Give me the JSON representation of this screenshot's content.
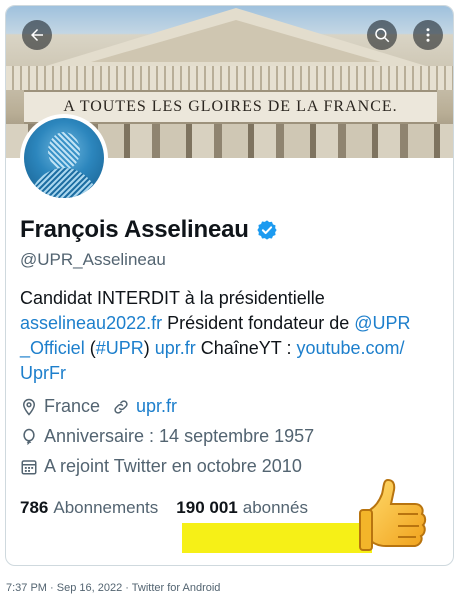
{
  "header": {
    "banner_inscription": "A TOUTES LES GLOIRES DE LA FRANCE.",
    "back_icon": "arrow-left-icon",
    "search_icon": "search-icon",
    "more_icon": "more-vertical-icon"
  },
  "profile": {
    "name": "François Asselineau",
    "verified_icon": "verified-badge-icon",
    "handle": "@UPR_Asselineau",
    "bio": {
      "line1": "Candidat INTERDIT à la présidentielle",
      "link1": "asselineau2022.fr",
      "text2": " Président fondateur de ",
      "mention1": "@UPR",
      "mention1b": "_Officiel",
      "text3": " (",
      "hashtag": "#UPR",
      "text4": ") ",
      "link2": "upr.fr",
      "text5": " ChaîneYT : ",
      "link3": "youtube.com/",
      "link3b": "UprFr"
    },
    "location": "France",
    "website": "upr.fr",
    "birthday": "Anniversaire : 14 septembre 1957",
    "joined": "A rejoint Twitter en octobre 2010"
  },
  "stats": {
    "following_count": "786",
    "following_label": "Abonnements",
    "followers_count": "190 001",
    "followers_label": "abonnés"
  },
  "colors": {
    "link": "#1d7fcc",
    "highlight": "#f6f017",
    "verified": "#1d9bf0"
  },
  "footer": {
    "timestamp": "7:37 PM · Sep 16, 2022 · Twitter for Android"
  }
}
